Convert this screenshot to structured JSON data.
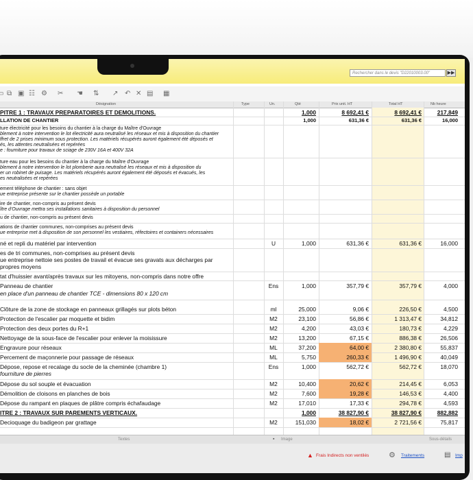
{
  "search": {
    "placeholder": "Rechercher dans le devis \"D22010003.00\"",
    "button": "▶▶"
  },
  "columns": {
    "designation": "Désignation",
    "type": "Type",
    "un": "Un.",
    "qte": "Qté",
    "prix": "Prix unit. HT",
    "total": "Total HT",
    "heures": "Nb heure"
  },
  "rows": [
    {
      "des": "PITRE 1 : TRAVAUX PREPARATOIRES ET DEMOLITIONS.",
      "qte": "1,000",
      "prix": "8 692,41 €",
      "total": "8 692,41 €",
      "heures": "217,849"
    },
    {
      "des": "LLATION DE CHANTIER",
      "qte": "1,000",
      "prix": "631,36 €",
      "total": "631,36 €",
      "heures": "16,000"
    },
    {
      "l1": "ture électricité pour les besoins du chantier à la charge du Maître d'Ouvrage",
      "l2": "blement à notre intervention le lot électricité aura neutralisé les réseaux et mis à disposition du chantier",
      "l3": "ffret de 2 prises minimum sous protection. Les matériels récupérés auront également été déposés et",
      "l4": "és, les attentes neutralisées et repérées",
      "l5": "e : fourniture pour travaux de sciage de 230V 16A et 400V 32A"
    },
    {
      "l1": "ture eau pour les besoins du chantier à la charge du Maître d'Ouvrage",
      "l2": "blement à notre intervention le lot plomberie aura neutralisé les réseaux et mis à disposition du",
      "l3": "er un robinet de puisage. Les matériels récupérés auront également été déposés et évacués, les",
      "l4": "es neutralisées et repérées"
    },
    {
      "l1": "ement téléphone de chantier : sans objet",
      "l2": "ue entreprise présente sur le chantier possède un portable"
    },
    {
      "l1": "ire de chantier, non-compris au présent devis",
      "l2": "ître d'Ouvrage mettra ses installations sanitaires à disposition du personnel"
    },
    {
      "l1": "u de chantier, non-compris au présent devis"
    },
    {
      "l1": "ations de chantier communes, non-comprises au présent devis",
      "l2": "ue entreprise met à disposition de son personnel les vestiaires, réfectoires et containers nécessaires"
    },
    {
      "des": "né et repli du matériel par intervention",
      "un": "U",
      "qte": "1,000",
      "prix": "631,36 €",
      "total": "631,36 €",
      "heures": "16,000"
    },
    {
      "l1": "es de tri communes, non-comprises au présent devis",
      "l2": "ue entreprise nettoie ses postes de travail et évacue ses gravats aux décharges par",
      "l3": "propres moyens"
    },
    {
      "des": "tat d'huissier avant/après travaux sur les mitoyens, non-compris dans notre offre"
    },
    {
      "l1": "Panneau de chantier",
      "l2": "en place d'un panneau de chantier TCE - dimensions 80 x 120 cm",
      "un": "Ens",
      "qte": "1,000",
      "prix": "357,79 €",
      "total": "357,79 €",
      "heures": "4,000"
    },
    {
      "des": "Clôture de la zone de stockage en panneaux grillagés sur plots béton",
      "un": "ml",
      "qte": "25,000",
      "prix": "9,06 €",
      "total": "226,50 €",
      "heures": "4,500"
    },
    {
      "des": "Protection de l'escalier par moquette et bidim",
      "un": "M2",
      "qte": "23,100",
      "prix": "56,86 €",
      "total": "1 313,47 €",
      "heures": "34,812"
    },
    {
      "des": "Protection des deux portes du R+1",
      "un": "M2",
      "qte": "4,200",
      "prix": "43,03 €",
      "total": "180,73 €",
      "heures": "4,229"
    },
    {
      "des": "Nettoyage de la sous-face de l'escalier pour enlever la moisissure",
      "un": "M2",
      "qte": "13,200",
      "prix": "67,15 €",
      "total": "886,38 €",
      "heures": "26,506"
    },
    {
      "des": "Engravure pour réseaux",
      "un": "ML",
      "qte": "37,200",
      "prix": "64,00 €",
      "total": "2 380,80 €",
      "heures": "55,837"
    },
    {
      "des": "Percement de maçonnerie pour passage de réseaux",
      "un": "ML",
      "qte": "5,750",
      "prix": "260,33 €",
      "total": "1 496,90 €",
      "heures": "40,049"
    },
    {
      "l1": "Dépose, repose et recalage du socle de la cheminée (chambre 1)",
      "l2": "fourniture de pierres",
      "un": "Ens",
      "qte": "1,000",
      "prix": "562,72 €",
      "total": "562,72 €",
      "heures": "18,070"
    },
    {
      "des": "Dépose du sol souple et évacuation",
      "un": "M2",
      "qte": "10,400",
      "prix": "20,62 €",
      "total": "214,45 €",
      "heures": "6,053"
    },
    {
      "des": "Démolition de cloisons en planches de bois",
      "un": "M2",
      "qte": "7,600",
      "prix": "19,28 €",
      "total": "146,53 €",
      "heures": "4,400"
    },
    {
      "des": "Dépose du rampant en plaques de plâtre compris échafaudage",
      "un": "M2",
      "qte": "17,010",
      "prix": "17,33 €",
      "total": "294,78 €",
      "heures": "4,593"
    },
    {
      "des": "ITRE 2 : TRAVAUX SUR PAREMENTS VERTICAUX.",
      "qte": "1,000",
      "prix": "38 827,90 €",
      "total": "38 827,90 €",
      "heures": "882,882"
    },
    {
      "des": "Decioquage du badigeon par grattage",
      "un": "M2",
      "qte": "151,030",
      "prix": "18,02 €",
      "total": "2 721,56 €",
      "heures": "75,817"
    }
  ],
  "bottom_tabs": {
    "textes": "Textes",
    "image": "Image",
    "sous_details": "Sous-détails"
  },
  "status": {
    "frais": "Frais Indirects non ventilés",
    "traitements": "Traitements",
    "imp": "Imp"
  },
  "colors": {
    "title_bar": "#f7ec7a",
    "highlight_column": "#fdf6d8",
    "orange_cell": "#f6b173",
    "warning": "#d42020"
  },
  "icons": [
    "copy-icon",
    "paste-icon",
    "save-icon",
    "tree-icon",
    "gear-icon",
    "cut-icon",
    "hand-icon",
    "sort-icon",
    "redo-icon",
    "undo-icon",
    "scissors-icon",
    "paste-icon",
    "print-icon",
    "warning-icon",
    "gears-icon",
    "printer-icon"
  ]
}
